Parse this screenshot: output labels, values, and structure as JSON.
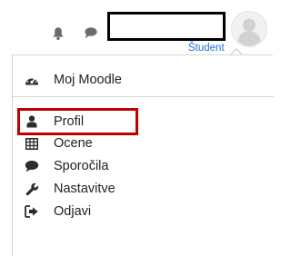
{
  "topbar": {
    "role_label": "Študent",
    "icons": {
      "notifications": "bell-icon",
      "messages": "chat-bubble-icon",
      "avatar": "user-avatar-icon"
    }
  },
  "menu": {
    "items": [
      {
        "label": "Moj Moodle",
        "icon": "dashboard-gauge-icon"
      },
      {
        "label": "Profil",
        "icon": "user-icon",
        "highlighted": true
      },
      {
        "label": "Ocene",
        "icon": "table-grid-icon"
      },
      {
        "label": "Sporočila",
        "icon": "comment-icon"
      },
      {
        "label": "Nastavitve",
        "icon": "wrench-icon"
      },
      {
        "label": "Odjavi",
        "icon": "sign-out-icon"
      }
    ]
  },
  "colors": {
    "highlight_border": "#c00000",
    "link": "#1f6fd1",
    "icon": "#6b6b6b"
  }
}
